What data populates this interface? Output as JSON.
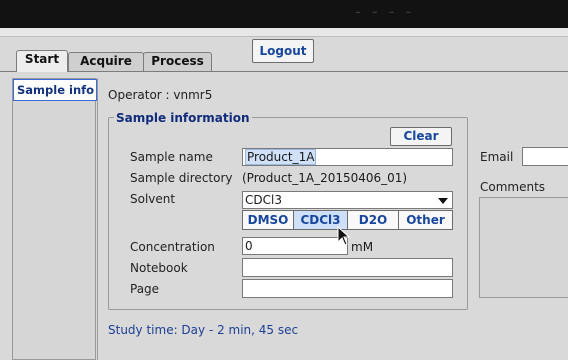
{
  "window": {
    "title_fragment": "- - - -"
  },
  "tabs": [
    "Start",
    "Acquire",
    "Process"
  ],
  "active_tab": "Start",
  "logout_label": "Logout",
  "sidebar": {
    "items": [
      {
        "label": "Sample info"
      }
    ]
  },
  "operator": {
    "text": "Operator : vnmr5"
  },
  "sample_information": {
    "title": "Sample information",
    "clear_label": "Clear",
    "sample_name": {
      "label": "Sample name",
      "value": "Product_1A"
    },
    "sample_directory": {
      "label": "Sample directory",
      "value": "(Product_1A_20150406_01)"
    },
    "solvent": {
      "label": "Solvent",
      "selected": "CDCl3",
      "buttons": [
        "DMSO",
        "CDCl3",
        "D2O",
        "Other"
      ],
      "active_button": "CDCl3"
    },
    "concentration": {
      "label": "Concentration",
      "value": "0",
      "unit": "mM"
    },
    "notebook": {
      "label": "Notebook",
      "value": ""
    },
    "page": {
      "label": "Page",
      "value": ""
    }
  },
  "email": {
    "label": "Email",
    "value": ""
  },
  "comments": {
    "label": "Comments",
    "value": ""
  },
  "study_time": "Study time: Day - 2 min, 45 sec",
  "colors": {
    "accent_text": "#17469e",
    "selected_tab_bg": "#cde0f7",
    "top_bar": "#121212"
  }
}
